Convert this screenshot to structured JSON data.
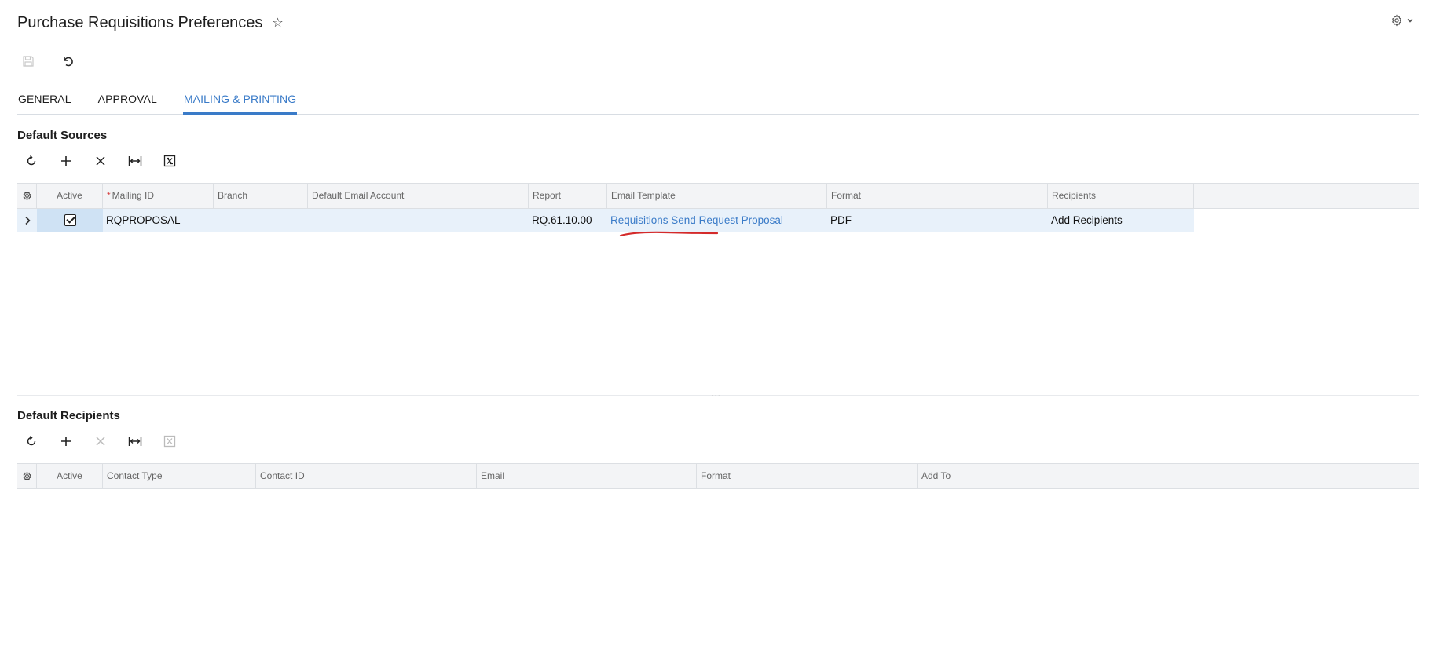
{
  "page": {
    "title": "Purchase Requisitions Preferences"
  },
  "tabs": [
    {
      "label": "GENERAL",
      "active": false
    },
    {
      "label": "APPROVAL",
      "active": false
    },
    {
      "label": "MAILING & PRINTING",
      "active": true
    }
  ],
  "default_sources": {
    "title": "Default Sources",
    "columns": {
      "active": "Active",
      "mailing_id": "Mailing ID",
      "branch": "Branch",
      "default_email_account": "Default Email Account",
      "report": "Report",
      "email_template": "Email Template",
      "format": "Format",
      "recipients": "Recipients"
    },
    "rows": [
      {
        "active": true,
        "mailing_id": "RQPROPOSAL",
        "branch": "",
        "default_email_account": "",
        "report": "RQ.61.10.00",
        "email_template": "Requisitions Send Request Proposal",
        "format": "PDF",
        "recipients": "Add Recipients"
      }
    ]
  },
  "splitter": {
    "handle": "..."
  },
  "default_recipients": {
    "title": "Default Recipients",
    "columns": {
      "active": "Active",
      "contact_type": "Contact Type",
      "contact_id": "Contact ID",
      "email": "Email",
      "format": "Format",
      "add_to": "Add To"
    },
    "rows": []
  },
  "colors": {
    "accent": "#3a7bc8",
    "row_selected": "#e8f1fa",
    "header_bg": "#f3f4f6",
    "required_marker": "#d63b3b",
    "annotation": "#d42a2a"
  },
  "icons": {
    "favorite": "star-icon",
    "settings": "gear-icon",
    "save": "save-icon",
    "undo": "undo-icon",
    "refresh": "refresh-icon",
    "add": "plus-icon",
    "delete": "close-icon",
    "fit": "fit-columns-icon",
    "export": "excel-export-icon"
  }
}
